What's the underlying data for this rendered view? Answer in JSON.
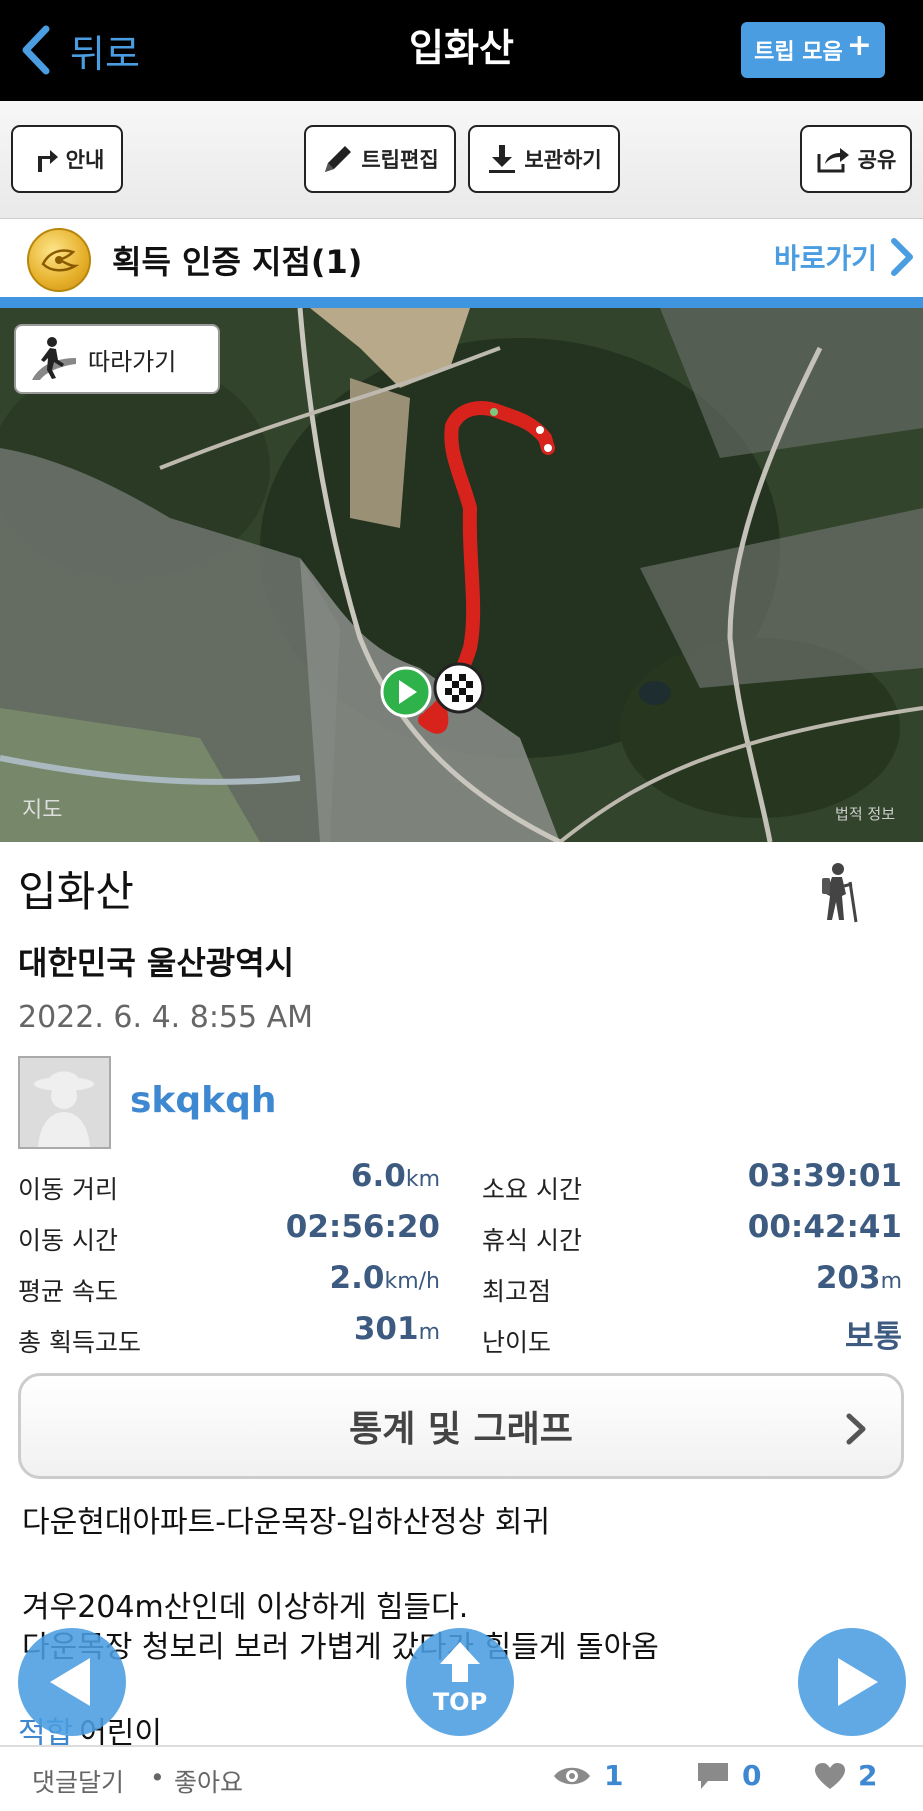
{
  "nav": {
    "back_label": "뒤로",
    "title": "입화산",
    "trip_collection_label": "트립 모음",
    "trip_collection_plus": "+"
  },
  "toolbar": {
    "guide_label": "안내",
    "edit_label": "트립편집",
    "save_label": "보관하기",
    "share_label": "공유"
  },
  "certification": {
    "label": "획득 인증 지점(1)",
    "go_label": "바로가기"
  },
  "map": {
    "follow_label": "따라가기",
    "credit": "지도",
    "legal": "법적 정보"
  },
  "trip": {
    "name": "입화산",
    "region": "대한민국 울산광역시",
    "date": "2022. 6. 4. 8:55 AM",
    "username": "skqkqh"
  },
  "stats": {
    "distance": {
      "label": "이동 거리",
      "value": "6.0",
      "unit": "km"
    },
    "total_time": {
      "label": "소요 시간",
      "value": "03:39:01",
      "unit": ""
    },
    "moving_time": {
      "label": "이동 시간",
      "value": "02:56:20",
      "unit": ""
    },
    "rest_time": {
      "label": "휴식 시간",
      "value": "00:42:41",
      "unit": ""
    },
    "avg_speed": {
      "label": "평균 속도",
      "value": "2.0",
      "unit": "km/h"
    },
    "max_altitude": {
      "label": "최고점",
      "value": "203",
      "unit": "m"
    },
    "total_ascent": {
      "label": "총 획득고도",
      "value": "301",
      "unit": "m"
    },
    "difficulty": {
      "label": "난이도",
      "value": "보통",
      "unit": ""
    }
  },
  "graph_button_label": "통계 및 그래프",
  "description": {
    "line1": "다운현대아파트-다운목장-입하산정상 회귀",
    "line2": "겨우204m산인데 이상하게 힘들다.",
    "line3": "다운목장 청보리 보러 가볍게 갔다가 힘들게 돌아옴"
  },
  "tags": {
    "label": "적합",
    "value": "어린이"
  },
  "fab": {
    "top_label": "TOP"
  },
  "footer": {
    "comment_label": "댓글달기",
    "dot": "•",
    "like_label": "좋아요",
    "views": "1",
    "comments": "0",
    "likes": "2"
  },
  "colors": {
    "accent": "#4a9de0",
    "stat_value": "#3d5a80",
    "route": "#d8231c"
  }
}
